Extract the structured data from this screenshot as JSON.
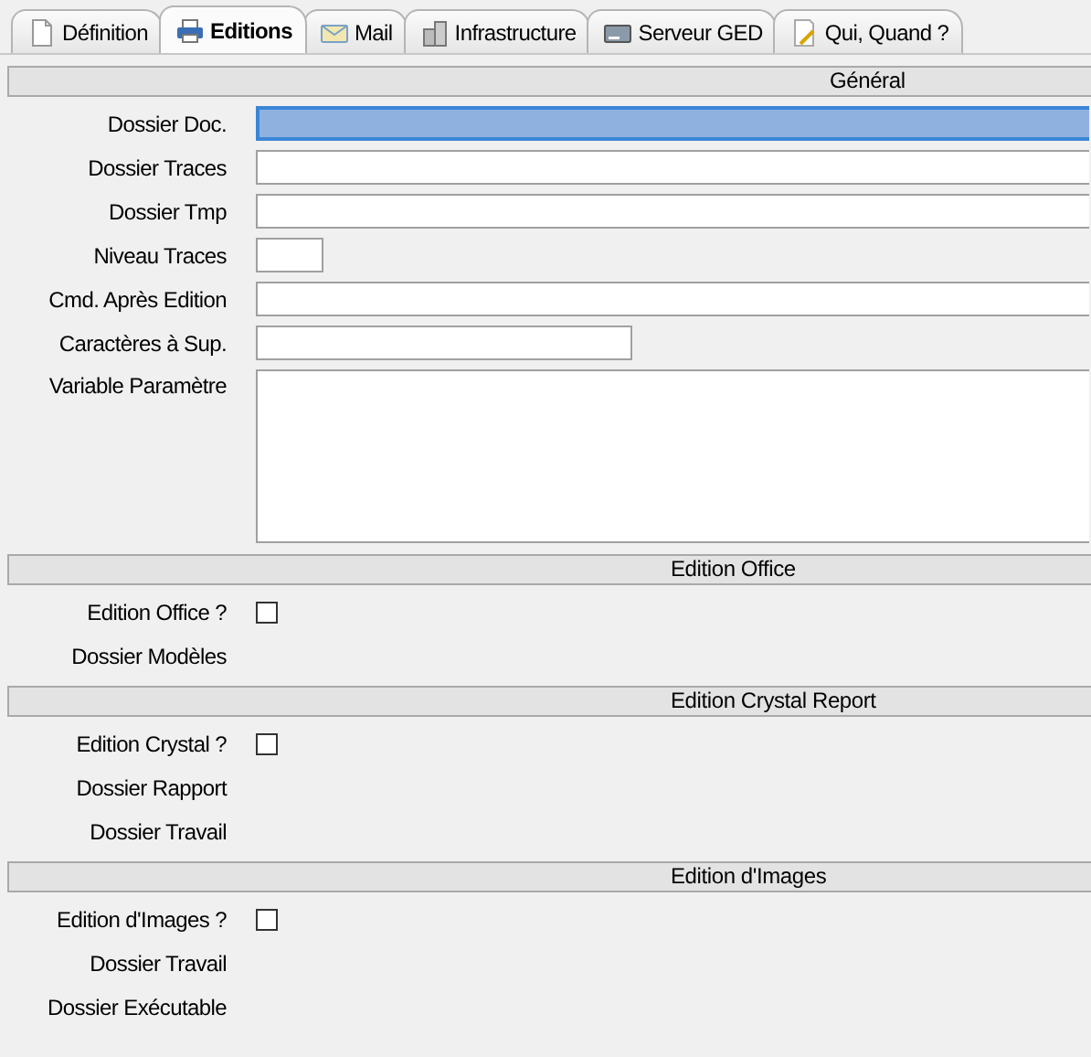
{
  "tabs": [
    {
      "label": "Définition",
      "selected": false
    },
    {
      "label": "Editions",
      "selected": true
    },
    {
      "label": "Mail",
      "selected": false
    },
    {
      "label": "Infrastructure",
      "selected": false
    },
    {
      "label": "Serveur GED",
      "selected": false
    },
    {
      "label": "Qui, Quand ?",
      "selected": false
    }
  ],
  "sections": [
    {
      "title": "Général",
      "fields": [
        {
          "label": "Dossier Doc.",
          "kind": "text",
          "focused": true
        },
        {
          "label": "Dossier Traces",
          "kind": "text",
          "focused": false
        },
        {
          "label": "Dossier Tmp",
          "kind": "text",
          "focused": false
        },
        {
          "label": "Niveau Traces",
          "kind": "short",
          "focused": false
        },
        {
          "label": "Cmd. Après Edition",
          "kind": "text",
          "focused": false
        },
        {
          "label": "Caractères à Sup.",
          "kind": "medium",
          "focused": false
        },
        {
          "label": "Variable Paramètre",
          "kind": "textarea",
          "focused": false
        }
      ]
    },
    {
      "title": "Edition Office",
      "fields": [
        {
          "label": "Edition Office ?",
          "kind": "checkbox",
          "checked": false
        },
        {
          "label": "Dossier Modèles",
          "kind": "label"
        }
      ]
    },
    {
      "title": "Edition Crystal Report",
      "fields": [
        {
          "label": "Edition Crystal ?",
          "kind": "checkbox",
          "checked": false
        },
        {
          "label": "Dossier Rapport",
          "kind": "label"
        },
        {
          "label": "Dossier Travail",
          "kind": "label"
        }
      ]
    },
    {
      "title": "Edition d'Images",
      "fields": [
        {
          "label": "Edition d'Images ?",
          "kind": "checkbox",
          "checked": false
        },
        {
          "label": "Dossier Travail",
          "kind": "label"
        },
        {
          "label": "Dossier Exécutable",
          "kind": "label"
        }
      ]
    }
  ]
}
